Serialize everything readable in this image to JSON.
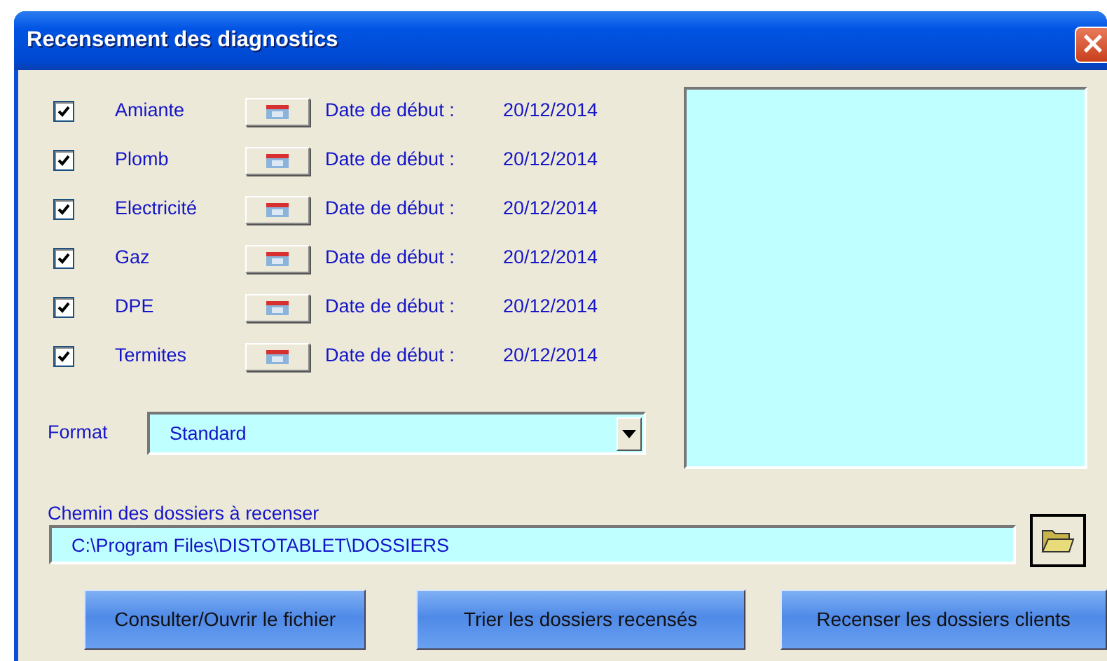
{
  "window": {
    "title": "Recensement des diagnostics",
    "close": "×"
  },
  "diagnostics": [
    {
      "label": "Amiante",
      "checked": true,
      "date_label": "Date de début :",
      "date": "20/12/2014"
    },
    {
      "label": "Plomb",
      "checked": true,
      "date_label": "Date de début :",
      "date": "20/12/2014"
    },
    {
      "label": "Electricité",
      "checked": true,
      "date_label": "Date de début :",
      "date": "20/12/2014"
    },
    {
      "label": "Gaz",
      "checked": true,
      "date_label": "Date de début :",
      "date": "20/12/2014"
    },
    {
      "label": "DPE",
      "checked": true,
      "date_label": "Date de début :",
      "date": "20/12/2014"
    },
    {
      "label": "Termites",
      "checked": true,
      "date_label": "Date de début :",
      "date": "20/12/2014"
    }
  ],
  "format": {
    "label": "Format",
    "value": "Standard"
  },
  "path": {
    "label": "Chemin des dossiers à recenser",
    "value": "C:\\Program Files\\DISTOTABLET\\DOSSIERS"
  },
  "buttons": [
    "Consulter/Ouvrir le fichier",
    "Trier les dossiers recensés",
    "Recenser les dossiers clients"
  ]
}
